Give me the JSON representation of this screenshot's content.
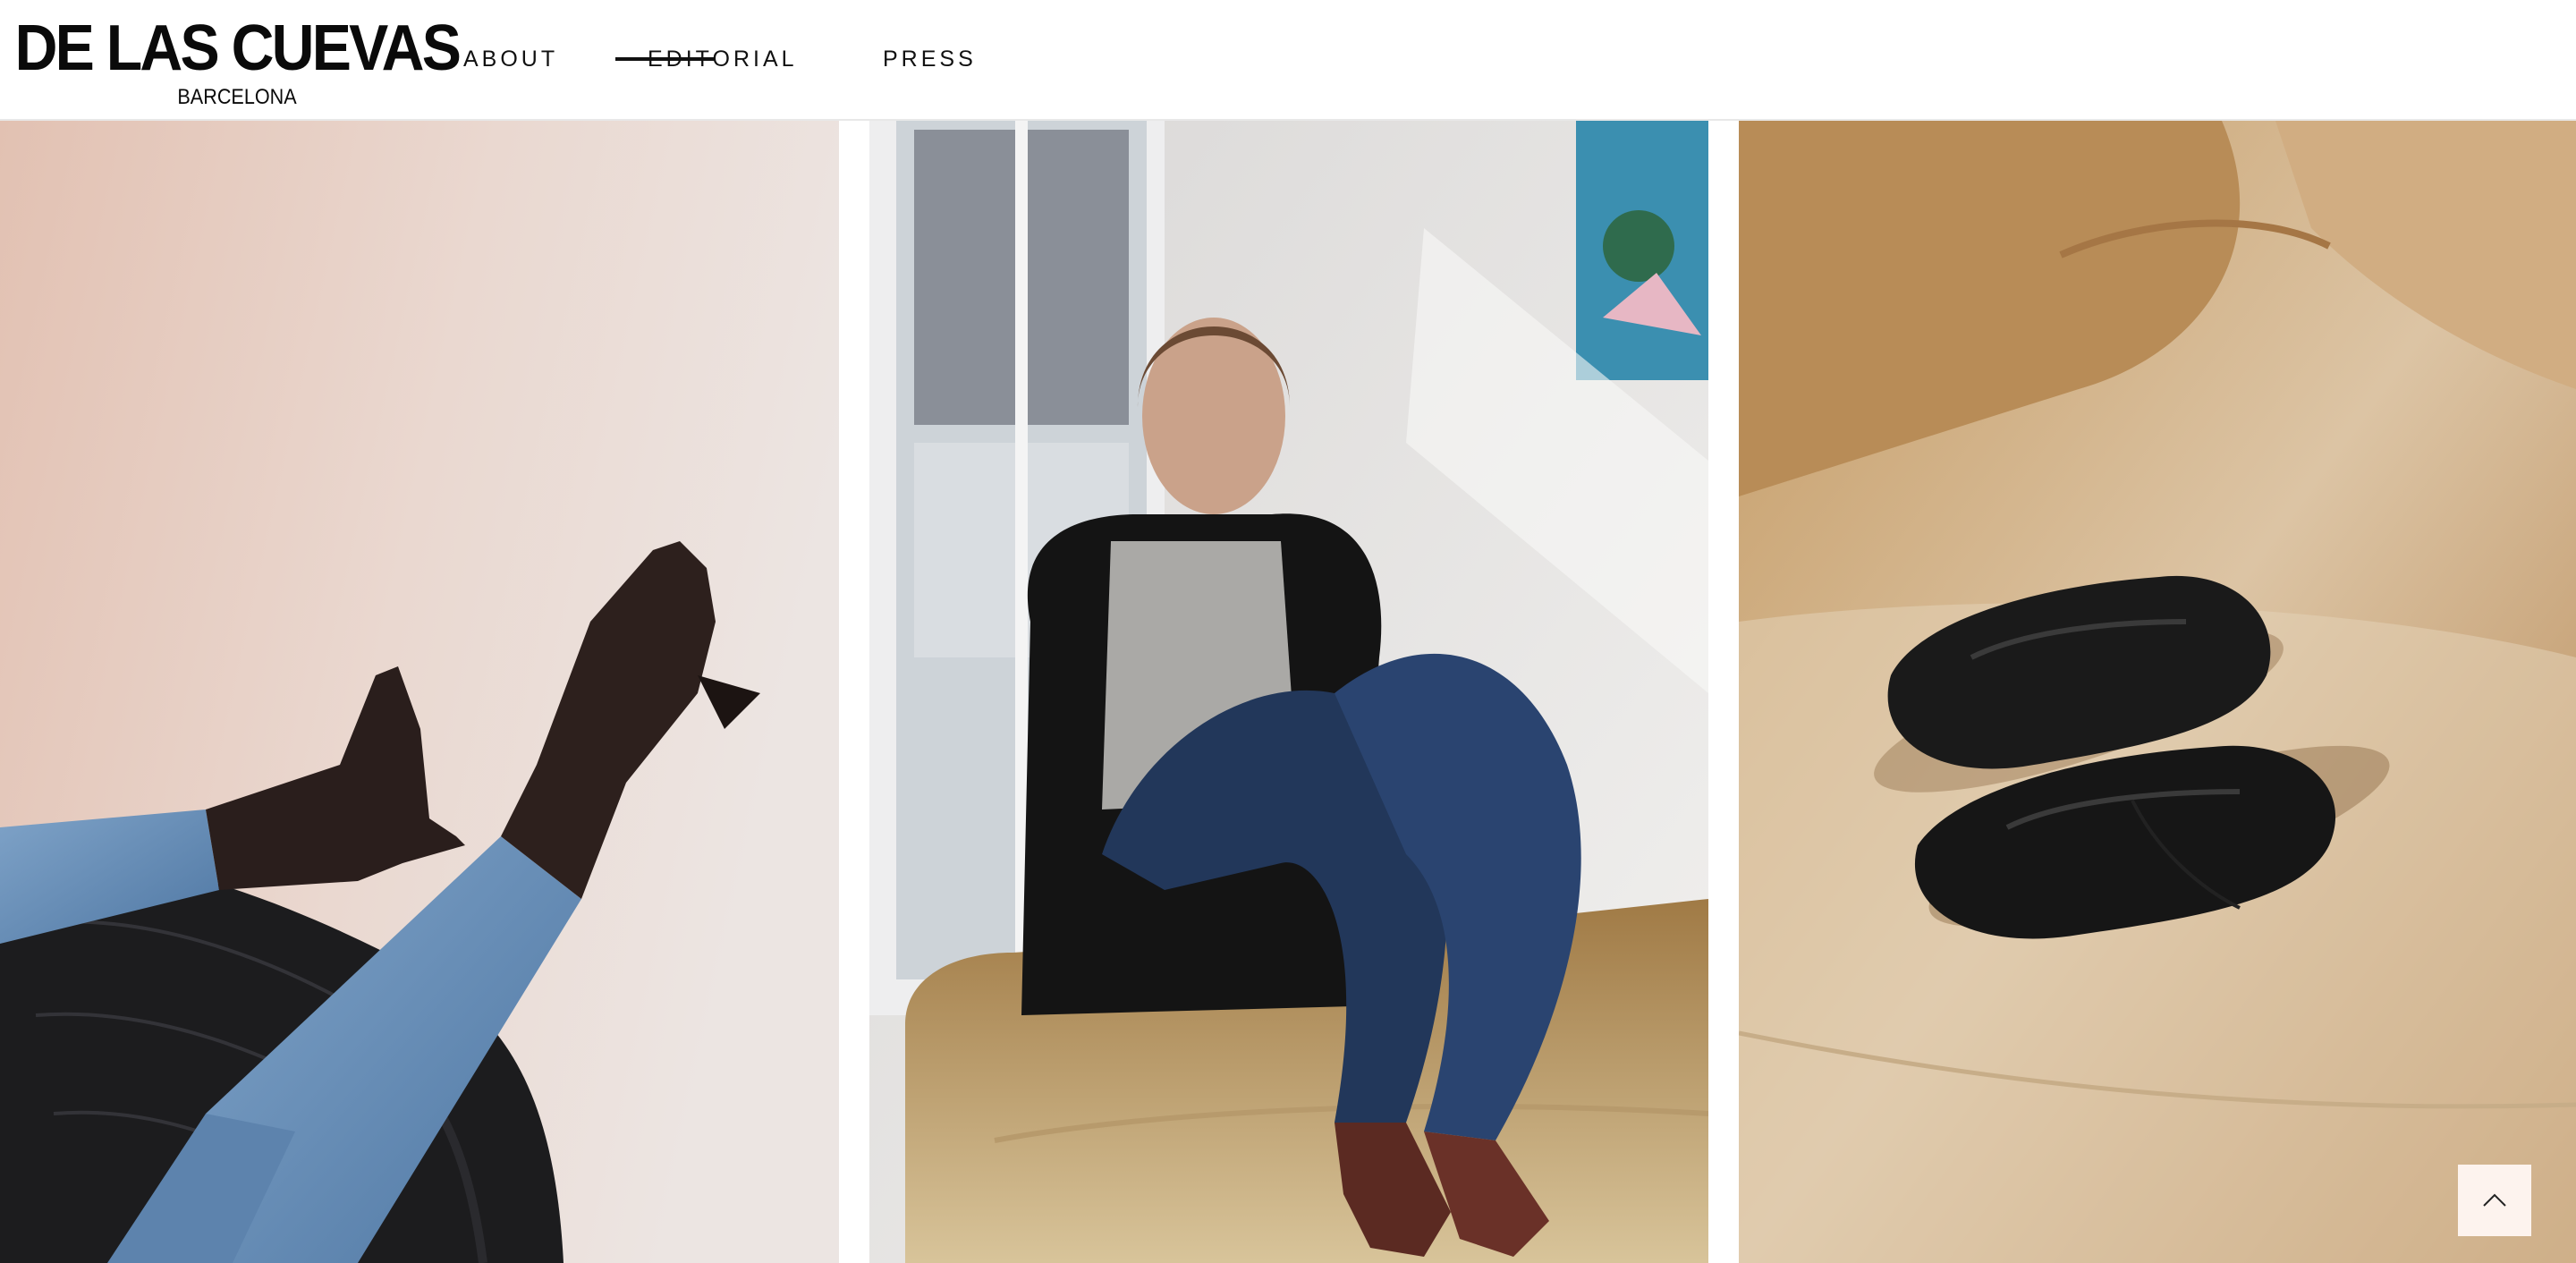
{
  "brand": {
    "name": "DE LAS CUEVAS",
    "city": "BARCELONA"
  },
  "nav": {
    "items": [
      {
        "label": "ABOUT",
        "active": false
      },
      {
        "label": "EDITORIAL",
        "active": true
      },
      {
        "label": "PRESS",
        "active": false
      }
    ]
  },
  "gallery": {
    "images": [
      {
        "subject": "legs-in-jeans-with-black-heeled-boots-on-leather-chair"
      },
      {
        "subject": "model-seated-on-leather-sofa-wearing-brown-platform-loafers"
      },
      {
        "subject": "black-ballet-flats-on-tan-leather-sofa"
      }
    ]
  },
  "back_to_top": {
    "icon": "chevron-up-icon"
  }
}
